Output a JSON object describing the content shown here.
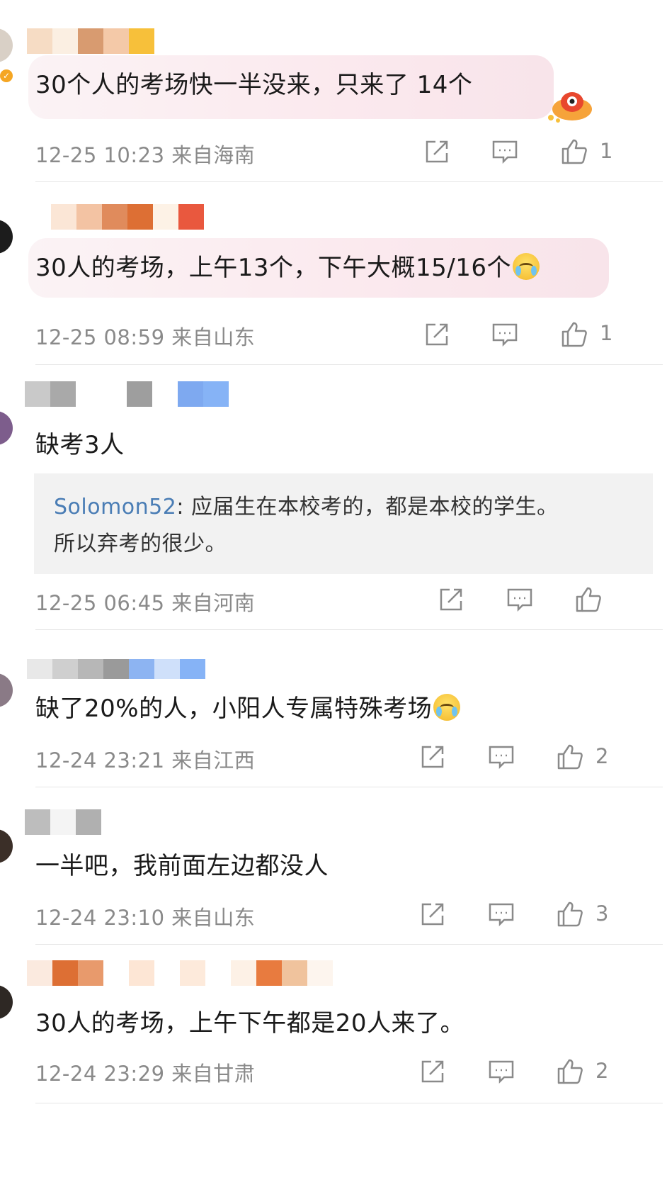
{
  "comments": [
    {
      "text": "30个人的考场快一半没来，只来了 14个",
      "meta": "12-25 10:23 来自海南",
      "likes": "1",
      "has_badge": true,
      "name_colors": [
        "#f6dcc4",
        "#fbefe2",
        "#d89b70",
        "#f4c9a8",
        "#f7c03a"
      ]
    },
    {
      "text": "30人的考场，上午13个，下午大概15/16个",
      "meta": "12-25 08:59 来自山东",
      "likes": "1",
      "name_colors": [
        "#fbe6d6",
        "#f3c3a3",
        "#e08b5c",
        "#dd6f34",
        "#fdf2e6",
        "#e9583e"
      ]
    },
    {
      "text": "缺考3人",
      "meta": "12-25 06:45 来自河南",
      "likes": "",
      "quote_author": "Solomon52",
      "quote_line1": "应届生在本校考的，都是本校的学生。",
      "quote_line2": "所以弃考的很少。",
      "name_colors": [
        "#c9c9c9",
        "#a9a9a9",
        "#ffffff",
        "#ffffff",
        "#9e9e9e",
        "#ffffff",
        "#7ea9f0",
        "#86b3f6"
      ]
    },
    {
      "text": "缺了20%的人，小阳人专属特殊考场",
      "meta": "12-24 23:21 来自江西",
      "likes": "2",
      "name_colors": [
        "#e8e8e8",
        "#cfcfcf",
        "#b7b7b7",
        "#9a9a9a",
        "#8db4f2",
        "#cfe0fa",
        "#86b3f6"
      ]
    },
    {
      "text": "一半吧，我前面左边都没人",
      "meta": "12-24 23:10 来自山东",
      "likes": "3",
      "name_colors": [
        "#bdbdbd",
        "#f4f4f4",
        "#b0b0b0"
      ]
    },
    {
      "text": "30人的考场，上午下午都是20人来了。",
      "meta": "12-24 23:29 来自甘肃",
      "likes": "2",
      "name_colors": [
        "#fbeadf",
        "#dd6f34",
        "#e89a6c",
        "#ffffff",
        "#fde6d5",
        "#ffffff",
        "#fdeadb",
        "#ffffff",
        "#fdf1e6",
        "#e87b3f",
        "#f0c39d",
        "#fdf5ee"
      ]
    }
  ],
  "icons": {
    "share": "share-icon",
    "comment": "comment-icon",
    "like": "like-icon",
    "emoji": "laugh-cry-emoji-icon"
  }
}
